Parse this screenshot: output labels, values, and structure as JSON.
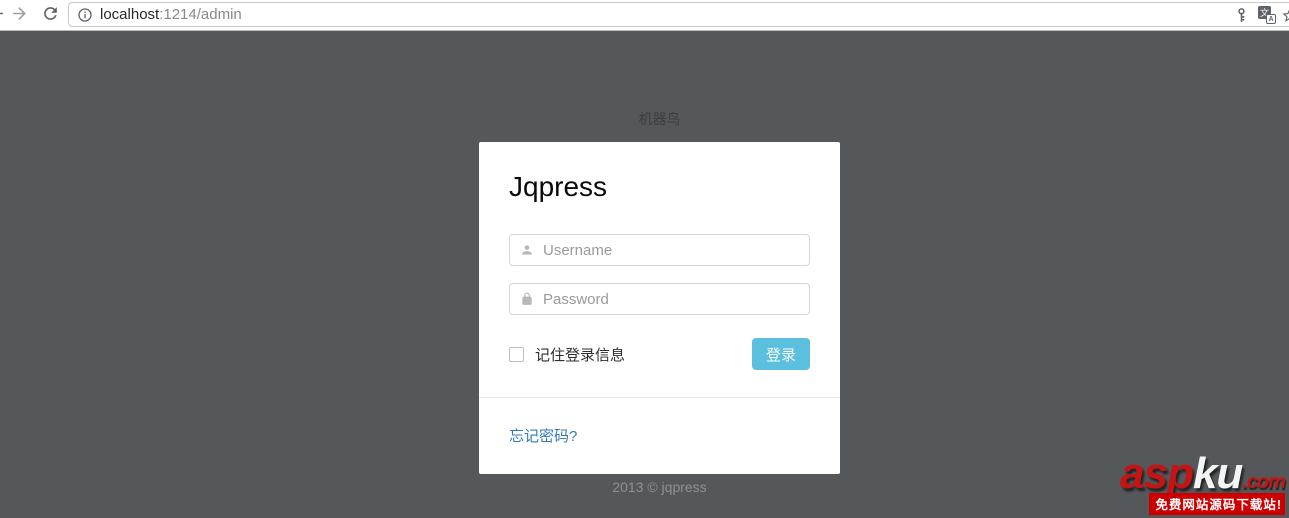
{
  "browser": {
    "url": {
      "host": "localhost",
      "path": ":1214/admin"
    }
  },
  "page": {
    "site_label": "机器鸟",
    "footer_text": "2013 © jqpress"
  },
  "login_card": {
    "title": "Jqpress",
    "username_placeholder": "Username",
    "password_placeholder": "Password",
    "remember_label": "记住登录信息",
    "login_button_label": "登录",
    "forgot_password_link": "忘记密码?"
  },
  "watermark": {
    "logo_part_asp": "asp",
    "logo_part_ku": "ku",
    "logo_part_com": ".com",
    "tagline": "免费网站源码下载站!"
  },
  "icons": {
    "back": "arrow-left",
    "forward": "arrow-right",
    "reload": "circular-arrow",
    "url_info": "info-circle",
    "password_key": "key",
    "translate": "translate",
    "translate_glyphs": {
      "back": "文",
      "front": "A"
    },
    "bookmark": "star-outline",
    "username_field": "person",
    "password_field": "lock"
  },
  "colors": {
    "page_background": "#54585b",
    "card_background": "#ffffff",
    "button_accent": "#5bc0de",
    "link_blue": "#337ab7",
    "watermark_red": "#cc0000"
  }
}
